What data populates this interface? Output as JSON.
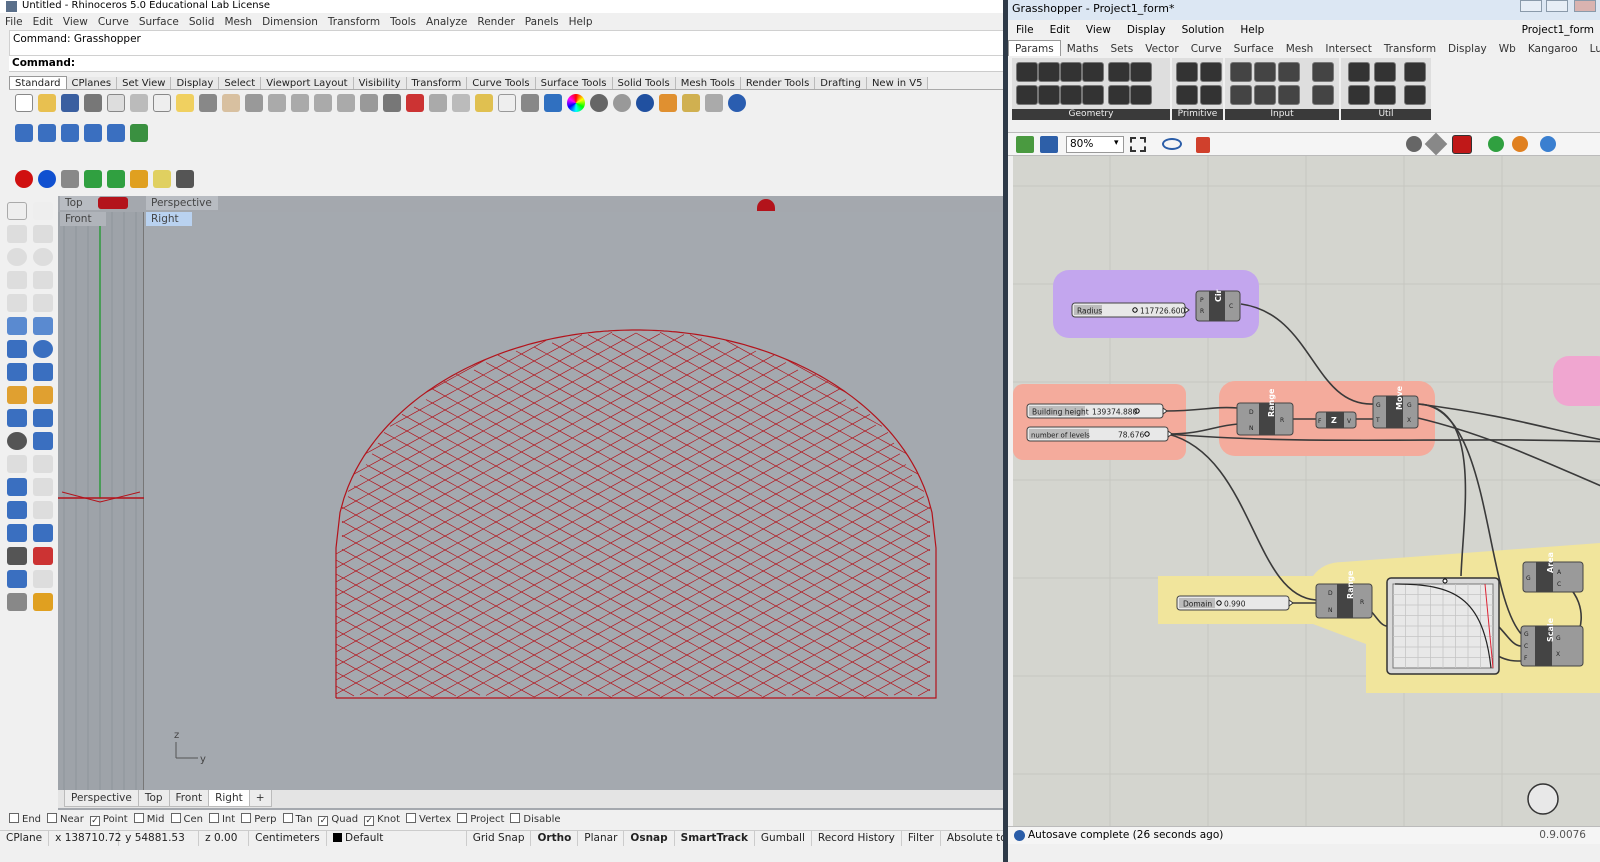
{
  "rhino": {
    "title": "Untitled - Rhinoceros 5.0 Educational Lab License",
    "menu": [
      "File",
      "Edit",
      "View",
      "Curve",
      "Surface",
      "Solid",
      "Mesh",
      "Dimension",
      "Transform",
      "Tools",
      "Analyze",
      "Render",
      "Panels",
      "Help"
    ],
    "command_history": "Command: Grasshopper",
    "command_prompt": "Command:",
    "toolbar_tabs": [
      "Standard",
      "CPlanes",
      "Set View",
      "Display",
      "Select",
      "Viewport Layout",
      "Visibility",
      "Transform",
      "Curve Tools",
      "Surface Tools",
      "Solid Tools",
      "Mesh Tools",
      "Render Tools",
      "Drafting",
      "New in V5"
    ],
    "viewports": {
      "top": "Top",
      "perspective": "Perspective",
      "front": "Front",
      "right": "Right"
    },
    "axis_labels": {
      "z": "z",
      "y": "y"
    },
    "viewport_tabs": [
      "Perspective",
      "Top",
      "Front",
      "Right",
      "+"
    ],
    "osnaps": [
      {
        "label": "End",
        "checked": false
      },
      {
        "label": "Near",
        "checked": false
      },
      {
        "label": "Point",
        "checked": true
      },
      {
        "label": "Mid",
        "checked": false
      },
      {
        "label": "Cen",
        "checked": false
      },
      {
        "label": "Int",
        "checked": false
      },
      {
        "label": "Perp",
        "checked": false
      },
      {
        "label": "Tan",
        "checked": false
      },
      {
        "label": "Quad",
        "checked": true
      },
      {
        "label": "Knot",
        "checked": true
      },
      {
        "label": "Vertex",
        "checked": false
      },
      {
        "label": "Project",
        "checked": false
      },
      {
        "label": "Disable",
        "checked": false
      }
    ],
    "status": {
      "cplane": "CPlane",
      "x": "x 138710.72",
      "y": "y 54881.53",
      "z": "z 0.00",
      "units": "Centimeters",
      "layer": "Default",
      "grid_snap": "Grid Snap",
      "ortho": "Ortho",
      "planar": "Planar",
      "osnap": "Osnap",
      "smarttrack": "SmartTrack",
      "gumball": "Gumball",
      "record_history": "Record History",
      "filter": "Filter",
      "tolerance": "Absolute tolerance"
    }
  },
  "grasshopper": {
    "title": "Grasshopper - Project1_form*",
    "menu": [
      "File",
      "Edit",
      "View",
      "Display",
      "Solution",
      "Help"
    ],
    "file_name": "Project1_form",
    "tabs": [
      "Params",
      "Maths",
      "Sets",
      "Vector",
      "Curve",
      "Surface",
      "Mesh",
      "Intersect",
      "Transform",
      "Display",
      "Wb",
      "Kangaroo",
      "LunchBox"
    ],
    "ribbon_groups": [
      "Geometry",
      "Primitive",
      "Input",
      "Util"
    ],
    "zoom": "80%",
    "nodes": {
      "radius_label": "Radius",
      "radius_value": "117726.600",
      "circle": "Cir",
      "building_height_label": "Building height",
      "building_height_value": "139374.880",
      "levels_label": "number of levels",
      "levels_value": "78.676",
      "range1": "Range",
      "z_vec": "Z",
      "move": "Move",
      "domain_label": "Domain",
      "domain_value": "0.990",
      "range2": "Range",
      "area": "Area",
      "scale": "Scale",
      "cir_in_p": "P",
      "cir_in_r": "R",
      "cir_out": "C",
      "range_in_d": "D",
      "range_in_n": "N",
      "range_out": "R",
      "z_in": "F",
      "z_out": "V",
      "move_in_g": "G",
      "move_in_t": "T",
      "move_out_g": "G",
      "move_out_x": "X",
      "area_in": "G",
      "area_out_a": "A",
      "area_out_c": "C",
      "scale_in_g": "G",
      "scale_in_c": "C",
      "scale_in_f": "F",
      "scale_out_g": "G",
      "scale_out_x": "X"
    },
    "autosave": "Autosave complete (26 seconds ago)",
    "version": "0.9.0076"
  },
  "colors": {
    "dome": "#b3131b",
    "group_purple": "#c3a6ee",
    "group_red": "#f4ab9c",
    "group_yellow": "#f1e59c",
    "canvas": "#d4d5cf"
  }
}
